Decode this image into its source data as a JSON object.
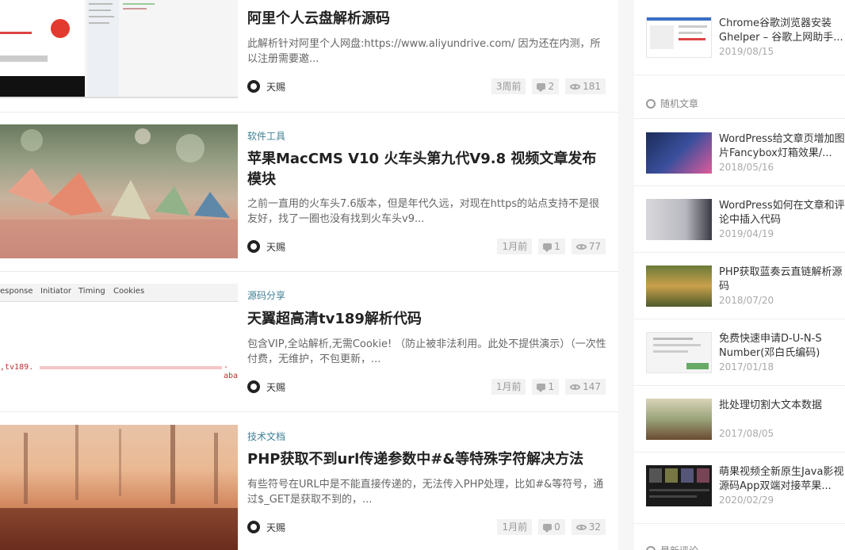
{
  "posts": [
    {
      "category": "",
      "title": "阿里个人云盘解析源码",
      "excerpt": "此解析针对阿里个人网盘:https://www.aliyundrive.com/ 因为还在内测，所以注册需要邀...",
      "author": "天赐",
      "time": "3周前",
      "comments": "2",
      "views": "181"
    },
    {
      "category": "软件工具",
      "title": "苹果MacCMS V10 火车头第九代V9.8 视频文章发布模块",
      "excerpt": "之前一直用的火车头7.6版本，但是年代久远，对现在https的站点支持不是很友好，找了一圈也没有找到火车头v9...",
      "author": "天赐",
      "time": "1月前",
      "comments": "1",
      "views": "77"
    },
    {
      "category": "源码分享",
      "title": "天翼超高清tv189解析代码",
      "excerpt": "包含VIP,全站解析,无需Cookie! （防止被非法利用。此处不提供演示）（一次性付费，无维护，不包更新，...",
      "author": "天赐",
      "time": "1月前",
      "comments": "1",
      "views": "147"
    },
    {
      "category": "技术文档",
      "title": "PHP获取不到url传递参数中#&等特殊字符解决方法",
      "excerpt": "有些符号在URL中是不能直接传递的，无法传入PHP处理，比如#&等符号，通过$_GET是获取不到的，...",
      "author": "天赐",
      "time": "1月前",
      "comments": "0",
      "views": "32"
    }
  ],
  "thumb3": {
    "tabs": [
      "esponse",
      "Initiator",
      "Timing",
      "Cookies"
    ],
    "left_text": ",tv189.",
    "right_text": "-aba"
  },
  "sidebar": {
    "top_item": {
      "title": "Chrome谷歌浏览器安装Ghelper – 谷歌上网助手...",
      "date": "2019/08/15"
    },
    "random_heading": "随机文章",
    "random_items": [
      {
        "title": "WordPress给文章页增加图片Fancybox灯箱效果/...",
        "date": "2018/05/16"
      },
      {
        "title": "WordPress如何在文章和评论中插入代码",
        "date": "2019/04/19"
      },
      {
        "title": "PHP获取蓝奏云直链解析源码",
        "date": "2018/07/20"
      },
      {
        "title": "免费快速申请D-U-N-S Number(邓白氏编码)",
        "date": "2017/01/18"
      },
      {
        "title": "批处理切割大文本数据",
        "date": "2017/08/05"
      },
      {
        "title": "萌果视频全新原生Java影视源码App双端对接苹果...",
        "date": "2020/02/29"
      }
    ],
    "next_heading": "最新评论"
  },
  "colors": {
    "category": "#3f7f95",
    "pill_bg": "#f2f2f2"
  }
}
